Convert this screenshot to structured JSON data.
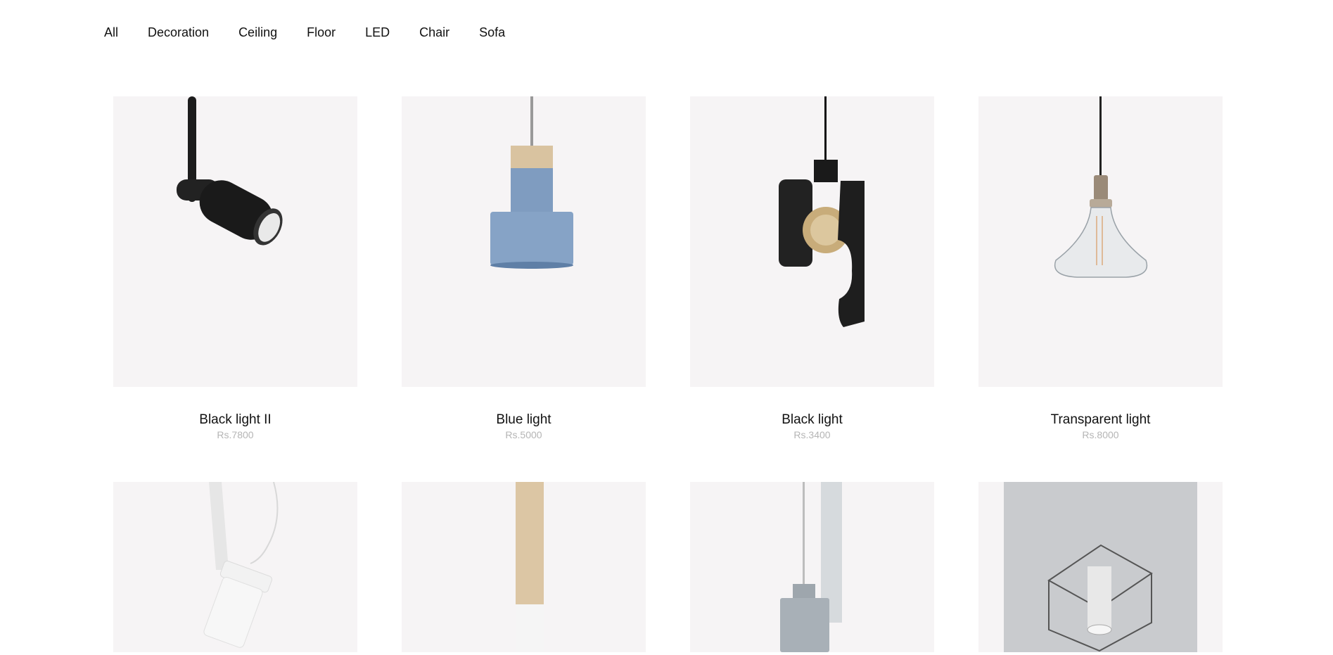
{
  "filters": [
    "All",
    "Decoration",
    "Ceiling",
    "Floor",
    "LED",
    "Chair",
    "Sofa"
  ],
  "products": [
    {
      "name": "Black light II",
      "price": "Rs.7800",
      "icon": "black-spot-lamp-image"
    },
    {
      "name": "Blue light",
      "price": "Rs.5000",
      "icon": "blue-pendant-lamp-image"
    },
    {
      "name": "Black light",
      "price": "Rs.3400",
      "icon": "black-bulb-pendant-image"
    },
    {
      "name": "Transparent light",
      "price": "Rs.8000",
      "icon": "glass-pendant-lamp-image"
    },
    {
      "icon": "white-pendant-lamp-image"
    },
    {
      "icon": "wood-pendant-lamp-image"
    },
    {
      "icon": "gray-pendant-lamp-image"
    },
    {
      "icon": "cube-ceiling-lamp-image"
    }
  ],
  "colors": {
    "thumb_bg": "#f6f4f5",
    "price": "#b5b5b5"
  }
}
